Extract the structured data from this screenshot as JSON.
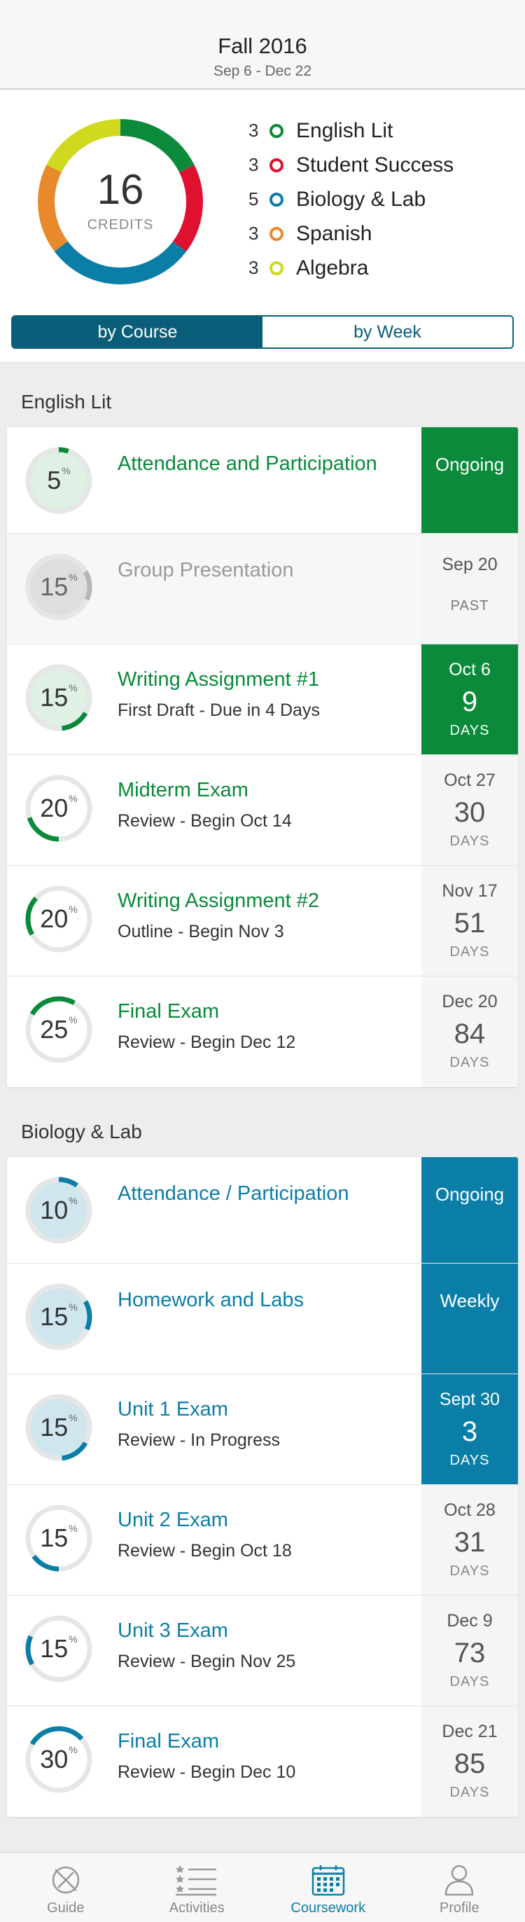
{
  "header": {
    "title": "Fall 2016",
    "dates": "Sep 6 - Dec 22"
  },
  "summary": {
    "credits": "16",
    "credits_label": "CREDITS",
    "legend": [
      {
        "credits": "3",
        "name": "English Lit",
        "color": "#0a8a3a"
      },
      {
        "credits": "3",
        "name": "Student Success",
        "color": "#e0102f"
      },
      {
        "credits": "5",
        "name": "Biology & Lab",
        "color": "#0b7ea8"
      },
      {
        "credits": "3",
        "name": "Spanish",
        "color": "#e8892b"
      },
      {
        "credits": "3",
        "name": "Algebra",
        "color": "#cfd91e"
      }
    ]
  },
  "segmented": {
    "by_course": "by Course",
    "by_week": "by Week"
  },
  "sections": [
    {
      "title": "English Lit",
      "color": "#0a8a3a",
      "items": [
        {
          "percent": "5",
          "title": "Attendance and Participation",
          "status": "Ongoing"
        },
        {
          "percent": "15",
          "title": "Group Presentation",
          "date": "Sep 20",
          "past": "PAST"
        },
        {
          "percent": "15",
          "title": "Writing Assignment #1",
          "subtitle": "First Draft - Due in 4 Days",
          "date": "Oct 6",
          "days": "9",
          "days_label": "DAYS"
        },
        {
          "percent": "20",
          "title": "Midterm Exam",
          "subtitle": "Review -  Begin Oct 14",
          "date": "Oct 27",
          "days": "30",
          "days_label": "DAYS"
        },
        {
          "percent": "20",
          "title": "Writing Assignment #2",
          "subtitle": "Outline - Begin Nov 3",
          "date": "Nov 17",
          "days": "51",
          "days_label": "DAYS"
        },
        {
          "percent": "25",
          "title": "Final Exam",
          "subtitle": "Review - Begin Dec 12",
          "date": "Dec 20",
          "days": "84",
          "days_label": "DAYS"
        }
      ]
    },
    {
      "title": "Biology & Lab",
      "color": "#0b7ea8",
      "items": [
        {
          "percent": "10",
          "title": "Attendance / Participation",
          "status": "Ongoing"
        },
        {
          "percent": "15",
          "title": "Homework and Labs",
          "status": "Weekly"
        },
        {
          "percent": "15",
          "title": "Unit 1 Exam",
          "subtitle": "Review -  In Progress",
          "date": "Sept 30",
          "days": "3",
          "days_label": "DAYS"
        },
        {
          "percent": "15",
          "title": "Unit 2 Exam",
          "subtitle": "Review - Begin Oct 18",
          "date": "Oct 28",
          "days": "31",
          "days_label": "DAYS"
        },
        {
          "percent": "15",
          "title": "Unit 3 Exam",
          "subtitle": "Review - Begin Nov 25",
          "date": "Dec 9",
          "days": "73",
          "days_label": "DAYS"
        },
        {
          "percent": "30",
          "title": "Final Exam",
          "subtitle": "Review - Begin Dec 10",
          "date": "Dec 21",
          "days": "85",
          "days_label": "DAYS"
        }
      ]
    }
  ],
  "percent_sign": "%",
  "tabbar": [
    {
      "label": "Guide",
      "icon": "compass-icon"
    },
    {
      "label": "Activities",
      "icon": "list-icon"
    },
    {
      "label": "Coursework",
      "icon": "calendar-icon",
      "active": true
    },
    {
      "label": "Profile",
      "icon": "person-icon"
    }
  ]
}
